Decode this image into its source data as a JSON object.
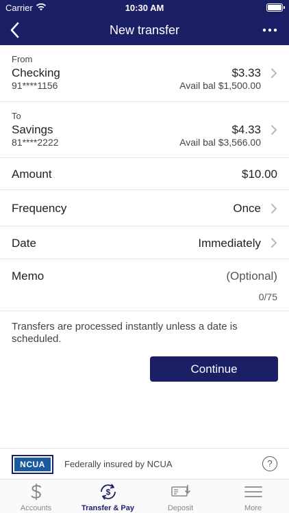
{
  "status": {
    "carrier": "Carrier",
    "time": "10:30 AM"
  },
  "header": {
    "title": "New transfer"
  },
  "from": {
    "label": "From",
    "account": "Checking",
    "number": "91****1156",
    "balance": "$3.33",
    "available": "Avail bal $1,500.00"
  },
  "to": {
    "label": "To",
    "account": "Savings",
    "number": "81****2222",
    "balance": "$4.33",
    "available": "Avail bal $3,566.00"
  },
  "fields": {
    "amount_label": "Amount",
    "amount_value": "$10.00",
    "frequency_label": "Frequency",
    "frequency_value": "Once",
    "date_label": "Date",
    "date_value": "Immediately",
    "memo_label": "Memo",
    "memo_placeholder": "(Optional)",
    "memo_counter": "0/75"
  },
  "note": "Transfers are processed instantly unless a date is scheduled.",
  "continue_label": "Continue",
  "footer": {
    "ncua_logo": "NCUA",
    "insured_text": "Federally insured by NCUA",
    "help_glyph": "?"
  },
  "tabs": [
    {
      "label": "Accounts",
      "icon": "dollar-icon",
      "active": false
    },
    {
      "label": "Transfer & Pay",
      "icon": "transfer-icon",
      "active": true
    },
    {
      "label": "Deposit",
      "icon": "check-deposit-icon",
      "active": false
    },
    {
      "label": "More",
      "icon": "menu-icon",
      "active": false
    }
  ],
  "colors": {
    "brand": "#1b1f66",
    "divider": "#e3e3e3",
    "tab_inactive": "#888888"
  }
}
